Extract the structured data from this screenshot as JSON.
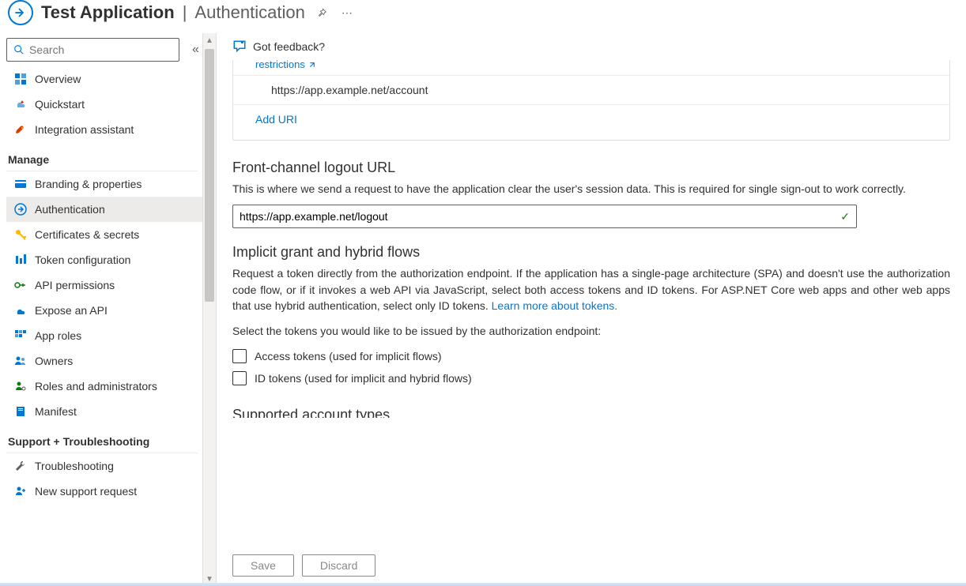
{
  "header": {
    "app_name": "Test Application",
    "page_name": "Authentication"
  },
  "sidebar": {
    "search_placeholder": "Search",
    "items_top": [
      {
        "icon": "grid",
        "label": "Overview",
        "color": "#0078d4"
      },
      {
        "icon": "rocket-cloud",
        "label": "Quickstart",
        "color": "#0078d4"
      },
      {
        "icon": "rocket",
        "label": "Integration assistant",
        "color": "#d83b01"
      }
    ],
    "section_manage": "Manage",
    "items_manage": [
      {
        "icon": "card",
        "label": "Branding & properties",
        "color": "#0078d4"
      },
      {
        "icon": "auth",
        "label": "Authentication",
        "color": "#0078d4",
        "active": true
      },
      {
        "icon": "key",
        "label": "Certificates & secrets",
        "color": "#ffb900"
      },
      {
        "icon": "bars",
        "label": "Token configuration",
        "color": "#0078d4"
      },
      {
        "icon": "api-perm",
        "label": "API permissions",
        "color": "#107c10"
      },
      {
        "icon": "cloud",
        "label": "Expose an API",
        "color": "#0078d4"
      },
      {
        "icon": "grid2",
        "label": "App roles",
        "color": "#0078d4"
      },
      {
        "icon": "people",
        "label": "Owners",
        "color": "#0078d4"
      },
      {
        "icon": "person-gear",
        "label": "Roles and administrators",
        "color": "#107c10"
      },
      {
        "icon": "manifest",
        "label": "Manifest",
        "color": "#0078d4"
      }
    ],
    "section_support": "Support + Troubleshooting",
    "items_support": [
      {
        "icon": "wrench",
        "label": "Troubleshooting",
        "color": "#605e5c"
      },
      {
        "icon": "person-plus",
        "label": "New support request",
        "color": "#0078d4"
      }
    ]
  },
  "toolbar": {
    "feedback": "Got feedback?"
  },
  "content": {
    "restrictions_link": "restrictions",
    "uri_value": "https://app.example.net/account",
    "add_uri": "Add URI",
    "logout": {
      "title": "Front-channel logout URL",
      "desc": "This is where we send a request to have the application clear the user's session data. This is required for single sign-out to work correctly.",
      "value": "https://app.example.net/logout"
    },
    "implicit": {
      "title": "Implicit grant and hybrid flows",
      "desc_a": "Request a token directly from the authorization endpoint. If the application has a single-page architecture (SPA) and doesn't use the authorization code flow, or if it invokes a web API via JavaScript, select both access tokens and ID tokens. For ASP.NET Core web apps and other web apps that use hybrid authentication, select only ID tokens. ",
      "learn_more": "Learn more about tokens.",
      "prompt": "Select the tokens you would like to be issued by the authorization endpoint:",
      "opt_access": "Access tokens (used for implicit flows)",
      "opt_id": "ID tokens (used for implicit and hybrid flows)"
    },
    "cutoff_title": "Supported account types"
  },
  "footer": {
    "save": "Save",
    "discard": "Discard"
  }
}
